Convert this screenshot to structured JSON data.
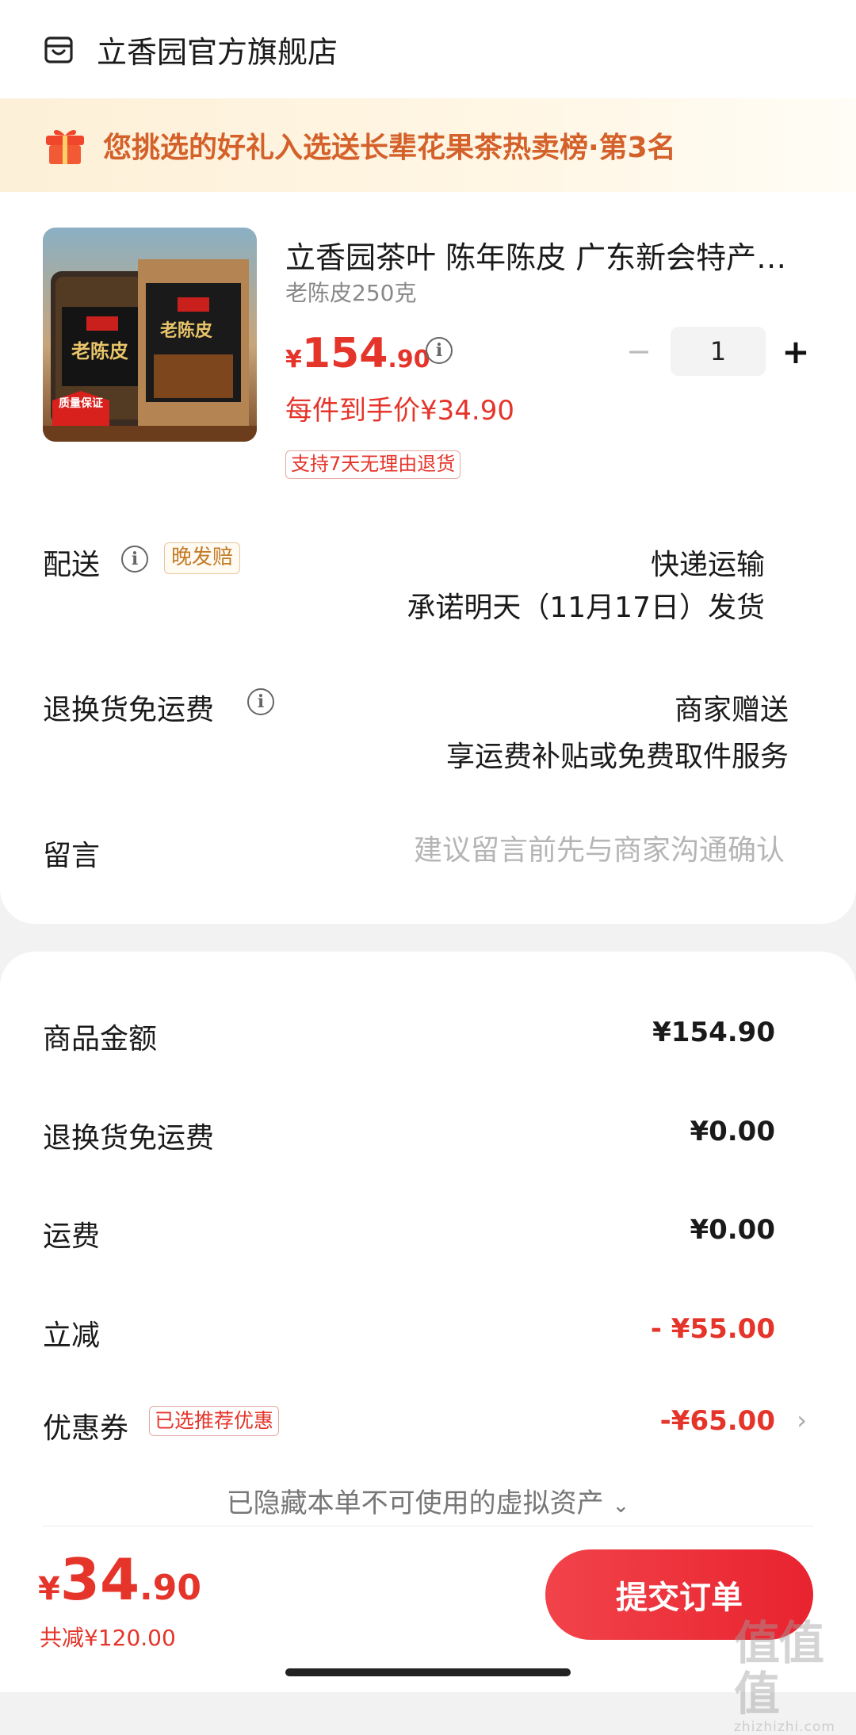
{
  "store": {
    "name": "立香园官方旗舰店",
    "icon": "store-icon"
  },
  "promo": {
    "text": "您挑选的好礼入选送长辈花果茶热卖榜·第3名",
    "icon": "gift-icon"
  },
  "product": {
    "image_label": "老陈皮",
    "image_badge": "质量保证",
    "title": "立香园茶叶 陈年陈皮 广东新会特产…",
    "spec": "老陈皮250克",
    "price_symbol": "¥",
    "price_int": "154",
    "price_dec": ".90",
    "quantity": "1",
    "unit_price_text": "每件到手价¥34.90",
    "return_policy": "支持7天无理由退货"
  },
  "delivery": {
    "label": "配送",
    "badge": "晚发赔",
    "method": "快递运输",
    "promise": "承诺明天（11月17日）发货"
  },
  "free_return": {
    "label": "退换货免运费",
    "value": "商家赠送",
    "desc": "享运费补贴或免费取件服务"
  },
  "message": {
    "label": "留言",
    "placeholder": "建议留言前先与商家沟通确认"
  },
  "summary": {
    "goods_label": "商品金额",
    "goods_value": "¥154.90",
    "return_fee_label": "退换货免运费",
    "return_fee_value": "¥0.00",
    "shipping_label": "运费",
    "shipping_value": "¥0.00",
    "discount_label": "立减",
    "discount_value": "- ¥55.00",
    "coupon_label": "优惠券",
    "coupon_badge": "已选推荐优惠",
    "coupon_value": "-¥65.00",
    "hidden_assets": "已隐藏本单不可使用的虚拟资产"
  },
  "footer": {
    "total_symbol": "¥",
    "total_int": "34",
    "total_dec": ".90",
    "saved": "共减¥120.00",
    "submit_label": "提交订单"
  },
  "watermark": {
    "glyphs": "值值值",
    "sub": "zhizhizhi.com"
  },
  "colors": {
    "accent_red": "#e5342a",
    "promo_orange": "#d4602a",
    "button_red": "#ee2e38"
  }
}
